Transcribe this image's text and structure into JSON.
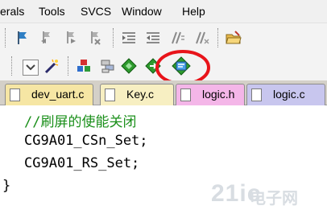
{
  "menubar": {
    "items": [
      "erals",
      "Tools",
      "SVCS",
      "Window",
      "Help"
    ]
  },
  "toolbar1": {
    "icons": [
      "flag-icon",
      "bookmark-prev-icon",
      "bookmark-next-icon",
      "bookmark-clear-icon",
      "indent-icon",
      "unindent-icon",
      "comment-icon",
      "uncomment-icon",
      "open-folder-icon"
    ]
  },
  "toolbar2": {
    "icons": [
      "dropdown-icon",
      "magic-wand-icon",
      "pack-installer-icon",
      "components-icon",
      "diamond-green-icon",
      "diamond-arrow-icon",
      "config-wizard-icon"
    ],
    "highlight_color": "#e8141a"
  },
  "tabs": [
    {
      "label": "dev_uart.c",
      "color": "#f6e6a4"
    },
    {
      "label": "Key.c",
      "color": "#f7efc2"
    },
    {
      "label": "logic.h",
      "color": "#f4b6e8"
    },
    {
      "label": "logic.c",
      "color": "#c8c6ee"
    }
  ],
  "editor": {
    "lines": [
      "//刷屏的使能关闭",
      "CG9A01_CSn_Set;",
      "CG9A01_RS_Set;",
      "}"
    ],
    "comment_color": "#1a8f1a"
  },
  "watermark": {
    "big": "21ic",
    "cn": "电子网"
  }
}
